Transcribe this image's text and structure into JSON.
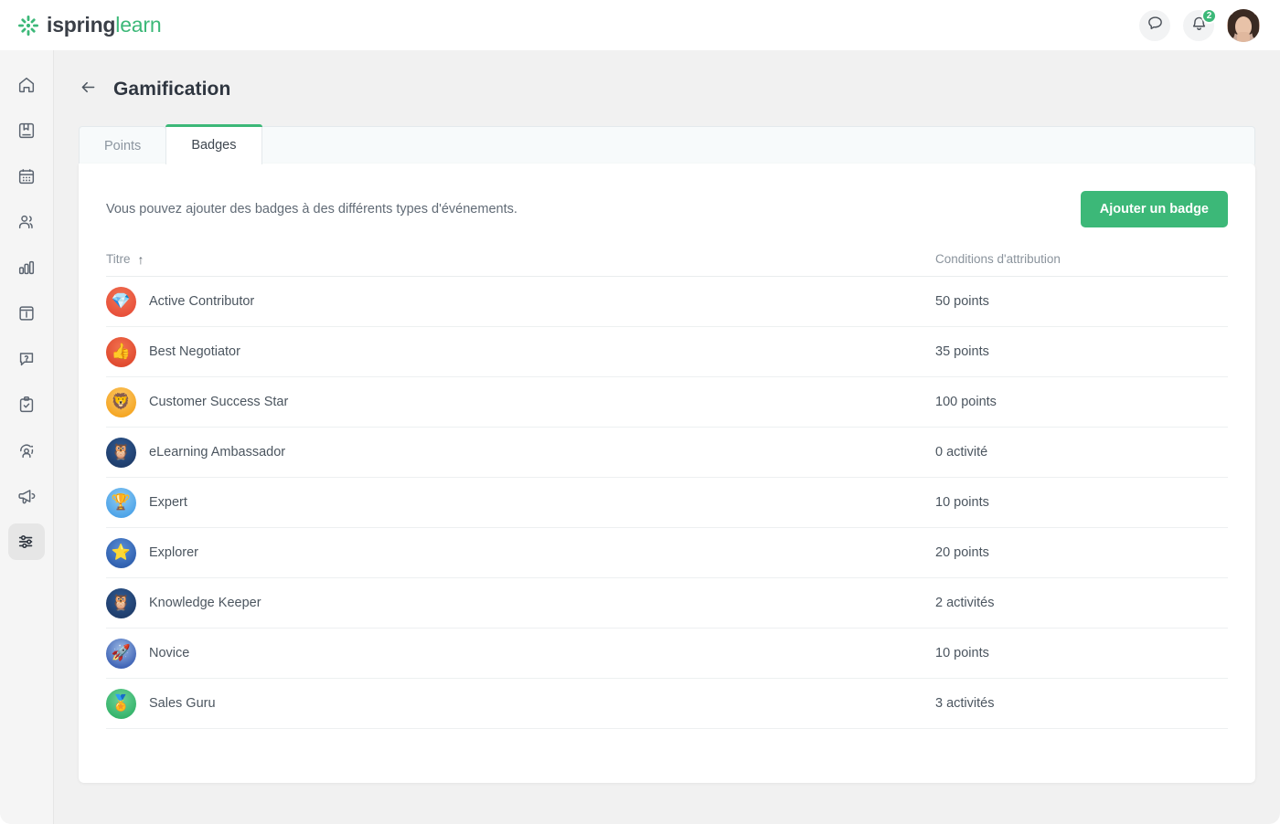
{
  "brand": {
    "name_bold": "ispring",
    "name_light": "learn",
    "logo_icon": "starburst-icon",
    "accent": "#3cb878"
  },
  "topbar": {
    "chat_icon": "chat-bubble-icon",
    "notifications_icon": "bell-icon",
    "notifications_count": "2",
    "avatar_icon": "user-avatar"
  },
  "sidebar": {
    "items": [
      {
        "icon": "home-icon",
        "name": "sidebar-item-home",
        "active": false
      },
      {
        "icon": "book-icon",
        "name": "sidebar-item-courses",
        "active": false
      },
      {
        "icon": "calendar-icon",
        "name": "sidebar-item-calendar",
        "active": false
      },
      {
        "icon": "users-icon",
        "name": "sidebar-item-users",
        "active": false
      },
      {
        "icon": "bar-chart-icon",
        "name": "sidebar-item-reports",
        "active": false
      },
      {
        "icon": "news-panel-icon",
        "name": "sidebar-item-news",
        "active": false
      },
      {
        "icon": "question-bubble-icon",
        "name": "sidebar-item-help",
        "active": false
      },
      {
        "icon": "clipboard-check-icon",
        "name": "sidebar-item-tasks",
        "active": false
      },
      {
        "icon": "user-performance-icon",
        "name": "sidebar-item-performance",
        "active": false
      },
      {
        "icon": "megaphone-icon",
        "name": "sidebar-item-announcements",
        "active": false
      },
      {
        "icon": "sliders-icon",
        "name": "sidebar-item-settings",
        "active": true
      }
    ]
  },
  "header": {
    "back_icon": "arrow-left-icon",
    "title": "Gamification"
  },
  "tabs": [
    {
      "label": "Points",
      "active": false
    },
    {
      "label": "Badges",
      "active": true
    }
  ],
  "content": {
    "description": "Vous pouvez ajouter des badges à des différents types d'événements.",
    "add_button": "Ajouter un badge"
  },
  "table": {
    "columns": [
      {
        "label": "Titre",
        "sort_icon": "arrow-up-icon",
        "sorted": "asc"
      },
      {
        "label": "Conditions d'attribution",
        "sort_icon": "",
        "sorted": ""
      }
    ],
    "rows": [
      {
        "title": "Active Contributor",
        "condition": "50 points",
        "badge_icon": "trophy-gem-badge",
        "bg": "#e8503a",
        "bg2": "#f07555",
        "glyph": "💎"
      },
      {
        "title": "Best Negotiator",
        "condition": "35 points",
        "badge_icon": "thumbs-up-badge",
        "bg": "#e04a2f",
        "bg2": "#f2714f",
        "glyph": "👍"
      },
      {
        "title": "Customer Success Star",
        "condition": "100 points",
        "badge_icon": "lion-crown-badge",
        "bg": "#f5a623",
        "bg2": "#fbc96b",
        "glyph": "🦁"
      },
      {
        "title": "eLearning Ambassador",
        "condition": "0 activité",
        "badge_icon": "owl-badge",
        "bg": "#1f3d6b",
        "bg2": "#2f5a93",
        "glyph": "🦉"
      },
      {
        "title": "Expert",
        "condition": "10 points",
        "badge_icon": "trophy-cup-badge",
        "bg": "#4da3e8",
        "bg2": "#8ecbf2",
        "glyph": "🏆"
      },
      {
        "title": "Explorer",
        "condition": "20 points",
        "badge_icon": "star-tower-badge",
        "bg": "#2f5fae",
        "bg2": "#5b8fd6",
        "glyph": "⭐"
      },
      {
        "title": "Knowledge Keeper",
        "condition": "2 activités",
        "badge_icon": "owl-badge",
        "bg": "#1f3d6b",
        "bg2": "#2f5a93",
        "glyph": "🦉"
      },
      {
        "title": "Novice",
        "condition": "10 points",
        "badge_icon": "rocket-badge",
        "bg": "#3f63b5",
        "bg2": "#9dbbe6",
        "glyph": "🚀"
      },
      {
        "title": "Sales Guru",
        "condition": "3 activités",
        "badge_icon": "medal-badge",
        "bg": "#35b36a",
        "bg2": "#6ed39a",
        "glyph": "🏅"
      }
    ]
  }
}
